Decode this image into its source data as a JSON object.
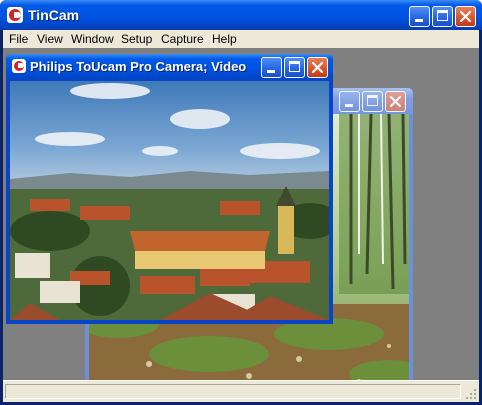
{
  "app": {
    "title": "TinCam",
    "icon": "tincam-logo-icon"
  },
  "menu": [
    "File",
    "View",
    "Window",
    "Setup",
    "Capture",
    "Help"
  ],
  "camera_window": {
    "title": "Philips ToUcam Pro Camera; Video",
    "feed": "town-rooftops-with-church-tower"
  },
  "back_window": {
    "title": "",
    "feed": "sunlit-birch-forest"
  },
  "colors": {
    "titlebar": "#0054e3",
    "menubar": "#ece9d8",
    "workspace": "#808080",
    "close_button": "#d9542a"
  }
}
